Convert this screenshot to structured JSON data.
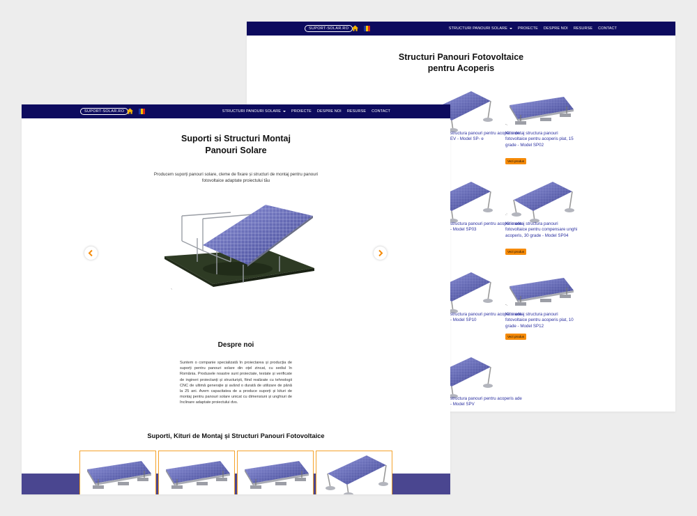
{
  "back_page": {
    "nav": {
      "logo": "SUPORT-SOLAR.RO",
      "items": [
        {
          "label": "STRUCTURI PANOURI SOLARE",
          "active": true,
          "dropdown": true
        },
        {
          "label": "PROIECTE"
        },
        {
          "label": "DESPRE NOI"
        },
        {
          "label": "RESURSE"
        },
        {
          "label": "CONTACT"
        }
      ]
    },
    "title": "Structuri Panouri Fotovoltaice pentru Acoperis",
    "products": [
      {
        "name": "structura panouri pentru acoperis de EV - Model SP- e",
        "button": ""
      },
      {
        "name": "Kit montaj structura panouri fotovoltaice pentru acoperis plat, 15 grade - Model SP02",
        "button": "Vezi produs"
      },
      {
        "name": "structura panouri pentru acoperis ade - Model SP03",
        "button": ""
      },
      {
        "name": "Kit montaj structura panouri fotovoltaice pentru compensare unghi acoperis, 30 grade - Model SP04",
        "button": "Vezi produs"
      },
      {
        "name": "structura panouri pentru acoperis ade - Model SP10",
        "button": ""
      },
      {
        "name": "Kit montaj structura panouri fotovoltaice pentru acoperis plat, 10 grade - Model SP12",
        "button": "Vezi produs"
      },
      {
        "name": "structura panouri pentru acoperis ade - Model SPV",
        "button": ""
      }
    ]
  },
  "front_page": {
    "nav": {
      "logo": "SUPORT-SOLAR.RO",
      "items": [
        {
          "label": "STRUCTURI PANOURI SOLARE",
          "dropdown": true
        },
        {
          "label": "PROIECTE"
        },
        {
          "label": "DESPRE NOI"
        },
        {
          "label": "RESURSE"
        },
        {
          "label": "CONTACT"
        }
      ]
    },
    "hero": {
      "title": "Suporti si Structuri Montaj Panouri Solare",
      "subtitle": "Producem suporți panouri solare, cleme de fixare și structuri de montaj pentru panouri fotovoltaice adaptate proiectului tău"
    },
    "about": {
      "heading": "Despre noi",
      "text": "Suntem o companie specializată în proiectarea și producția de suporți pentru panouri solare din oțel zincat, cu sediul în România. Produsele noastre sunt proiectate, testate și verificate de ingineri proiectanți și structuriști, fiind realizate cu tehnologii CNC de ultimă generație și având o durată de utilizare de până la 25 ani. Avem capacitatea de a produce suporți și kituri de montaj pentru panouri solare unicat cu dimensiuni și unghiuri de înclinare adaptate proiectului dvs."
    },
    "products_heading": "Suporti, Kituri de Montaj și Structuri Panouri Fotovoltaice"
  },
  "colors": {
    "nav_bg": "#0d0b5e",
    "accent": "#f7b500",
    "button": "#f58a07",
    "product_link": "#2a2fa0",
    "band": "#4a4690",
    "card_border": "#f5a22a",
    "flag": [
      "#1e3a9f",
      "#f6c400",
      "#d52b1e"
    ]
  },
  "icons": [
    "home-icon",
    "flag-romania-icon",
    "chevron-left-icon",
    "chevron-right-icon",
    "caret-down-icon"
  ]
}
